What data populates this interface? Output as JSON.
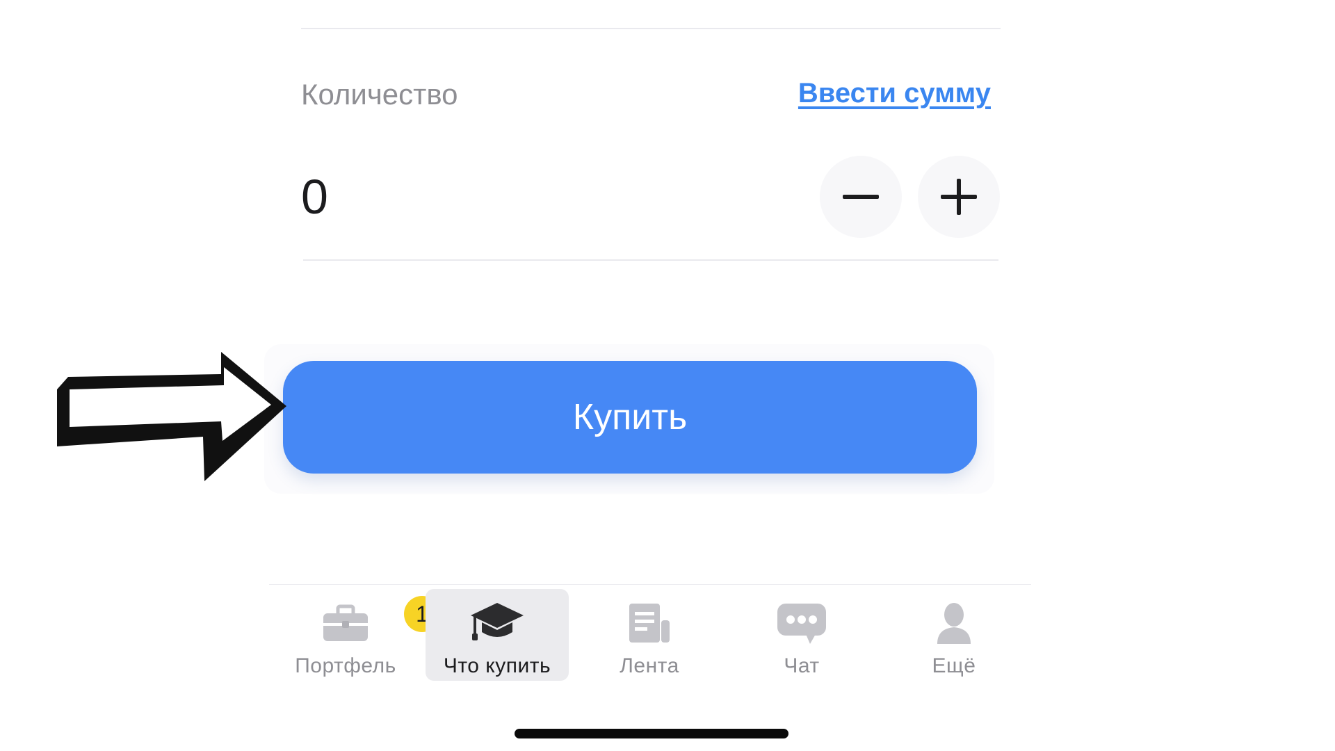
{
  "quantity": {
    "label": "Количество",
    "enter_sum_link": "Ввести сумму",
    "value": "0"
  },
  "buy_button": {
    "label": "Купить"
  },
  "tabs": [
    {
      "label": "Портфель",
      "icon": "briefcase-icon",
      "badge": "1",
      "active": false
    },
    {
      "label": "Что купить",
      "icon": "graduation-cap-icon",
      "active": true
    },
    {
      "label": "Лента",
      "icon": "news-feed-icon",
      "active": false
    },
    {
      "label": "Чат",
      "icon": "chat-bubble-icon",
      "active": false
    },
    {
      "label": "Ещё",
      "icon": "person-icon",
      "active": false
    }
  ],
  "colors": {
    "accent": "#4688f5",
    "link": "#3a86f0",
    "badge": "#f7d325"
  }
}
